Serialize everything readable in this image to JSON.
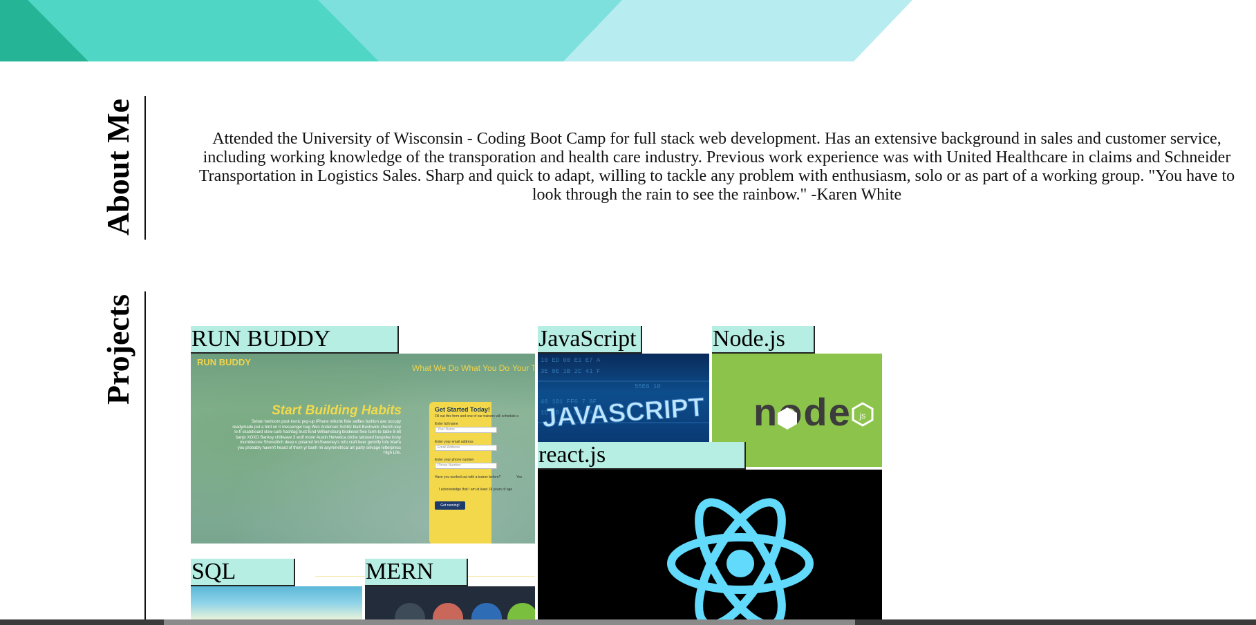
{
  "about": {
    "heading": "About Me",
    "text": "Attended the University of Wisconsin - Coding Boot Camp for full stack web development. Has an extensive background in sales and customer service, including working knowledge of the transporation and health care industry. Previous work experience was with United Healthcare in claims and Schneider Transportation in Logistics Sales. Sharp and quick to adapt, willing to tackle any problem with enthusiasm, solo or as part of a working group. \"You have to look through the rain to see the rainbow.\" -Karen White"
  },
  "projects": {
    "heading": "Projects",
    "cards": [
      {
        "label": "RUN BUDDY"
      },
      {
        "label": "JavaScript"
      },
      {
        "label": "Node.js"
      },
      {
        "label": "react.js"
      },
      {
        "label": "SQL"
      },
      {
        "label": "MERN"
      }
    ],
    "run_buddy_preview": {
      "brand": "RUN BUDDY",
      "nav": [
        "What We Do",
        "What You Do",
        "Your Tr"
      ],
      "headline": "Start Building Habits",
      "body": "Seitan heirloom post-ironic pop-up iPhone mlkshk fixie selfies fashion axe occupy readymade put a bird on it messenger bag Wes Anderson Schlitz blatt Bushwick church-key lo-fi skateboard slow-carb hashtag trust fund Williamsburg biodiesel fixie farm-to-table 8-bit banjo XOXO Banksy chillwave 3 wolf moon Austin Helvetica cliche tattooed bespoke irony mumblecore Shoreditch deep v polaroid McSweeney's tofu craft beer gentrify tofu Marfa you probably haven't heard of them yr banh mi asymmetrical art party selvage letterpress High Life.",
      "form_title": "Get Started Today!",
      "form_subtitle": "Fill out this form and one of our trainers will schedule a",
      "fields": [
        {
          "label": "Enter full name",
          "placeholder": "Your Name"
        },
        {
          "label": "Enter your email address",
          "placeholder": "Email Address"
        },
        {
          "label": "Enter your phone number",
          "placeholder": "Phone Number"
        }
      ],
      "question": "Have you worked out with a trainer before?",
      "yes_label": "Yes",
      "acknowledge": "I acknowledge that I am at least 18 years of age",
      "submit": "Get running!"
    },
    "javascript_image_text": "JAVASCRIPT",
    "node_logo_text": "node"
  },
  "colors": {
    "label_background": "#b7eee3",
    "node_green": "#8cc34b",
    "react_blue": "#61dafb"
  }
}
